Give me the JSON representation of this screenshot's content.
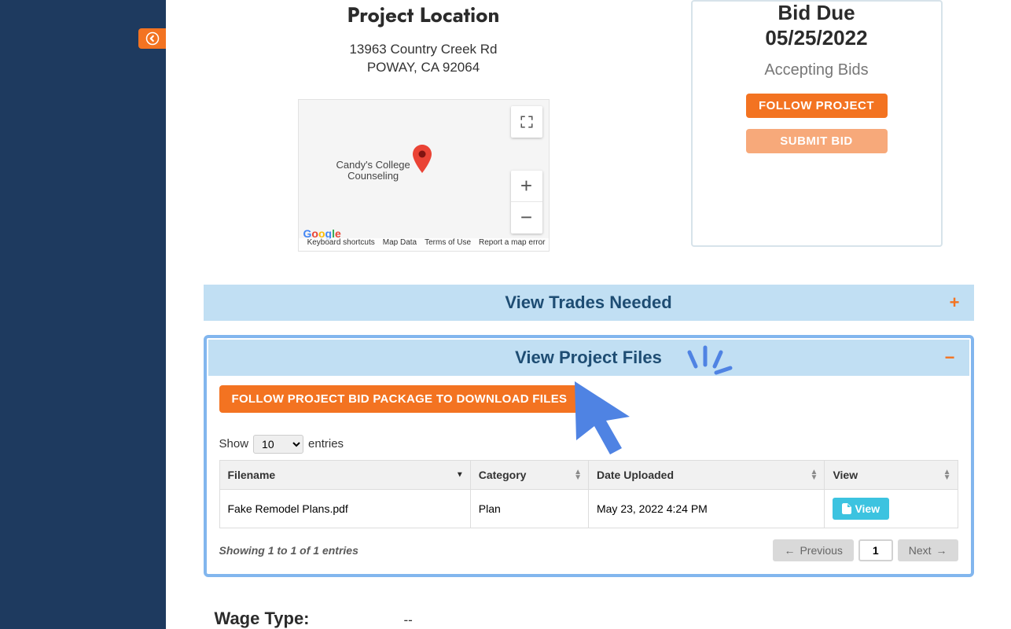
{
  "sidebar": {
    "collapse_icon": "arrow-left"
  },
  "location": {
    "heading": "Project Location",
    "address_line1": "13963 Country Creek Rd",
    "address_line2": "POWAY, CA 92064",
    "map": {
      "poi_label": "Candy's College\nCounseling",
      "fullscreen_icon": "fullscreen",
      "zoom_in": "+",
      "zoom_out": "−",
      "logo": "Google",
      "attrib": {
        "shortcuts": "Keyboard shortcuts",
        "mapdata": "Map Data",
        "terms": "Terms of Use",
        "report": "Report a map error"
      }
    }
  },
  "bid": {
    "heading": "Bid Due",
    "date": "05/25/2022",
    "status": "Accepting Bids",
    "follow_label": "FOLLOW PROJECT",
    "submit_label": "SUBMIT BID"
  },
  "trades": {
    "header": "View Trades Needed",
    "toggle_icon": "plus"
  },
  "files": {
    "header": "View Project Files",
    "toggle_icon": "minus",
    "download_label": "FOLLOW PROJECT BID PACKAGE TO DOWNLOAD FILES",
    "show_label": "Show",
    "entries_label": "entries",
    "page_size": "10",
    "columns": {
      "filename": "Filename",
      "category": "Category",
      "uploaded": "Date Uploaded",
      "view": "View"
    },
    "rows": [
      {
        "filename": "Fake Remodel Plans.pdf",
        "category": "Plan",
        "uploaded": "May 23, 2022 4:24 PM",
        "view_label": "View"
      }
    ],
    "info": "Showing 1 to 1 of 1 entries",
    "pager": {
      "prev": "Previous",
      "page": "1",
      "next": "Next"
    }
  },
  "wage": {
    "label": "Wage Type:",
    "value": "--"
  }
}
